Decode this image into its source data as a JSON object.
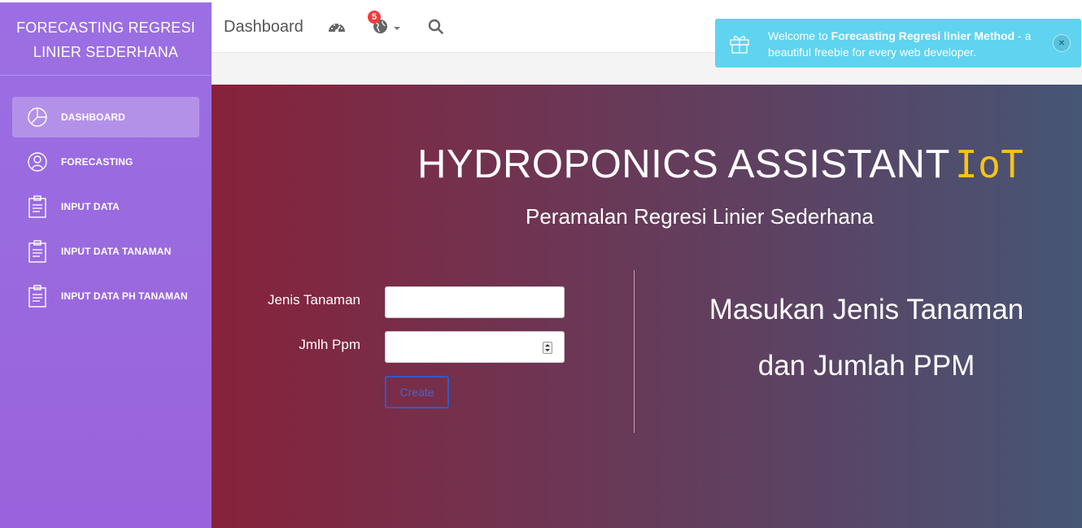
{
  "sidebar": {
    "brand_line1": "FORECASTING REGRESI",
    "brand_line2": "LINIER SEDERHANA",
    "items": [
      {
        "label": "DASHBOARD",
        "icon": "pie-chart-icon"
      },
      {
        "label": "FORECASTING",
        "icon": "user-icon"
      },
      {
        "label": "INPUT DATA",
        "icon": "clipboard-icon"
      },
      {
        "label": "INPUT DATA TANAMAN",
        "icon": "clipboard-icon"
      },
      {
        "label": "INPUT DATA PH TANAMAN",
        "icon": "clipboard-icon"
      }
    ]
  },
  "navbar": {
    "title": "Dashboard",
    "notification_count": "5"
  },
  "notification": {
    "prefix": "Welcome to ",
    "bold": "Forecasting Regresi linier Method",
    "suffix": " - a beautiful freebie for every web developer.",
    "close": "×"
  },
  "hero": {
    "title": "HYDROPONICS ASSISTANT",
    "title_accent": "IoT",
    "subtitle": "Peramalan Regresi Linier Sederhana",
    "form": {
      "label_jenis": "Jenis Tanaman",
      "label_ppm": "Jmlh Ppm",
      "create_label": "Create"
    },
    "side_line1": "Masukan Jenis Tanaman",
    "side_line2": "dan Jumlah PPM"
  },
  "colors": {
    "sidebar": "#9b6fe3",
    "accent_iot": "#f7c21a",
    "notification": "#5fd3ef",
    "badge": "#f5393d"
  }
}
